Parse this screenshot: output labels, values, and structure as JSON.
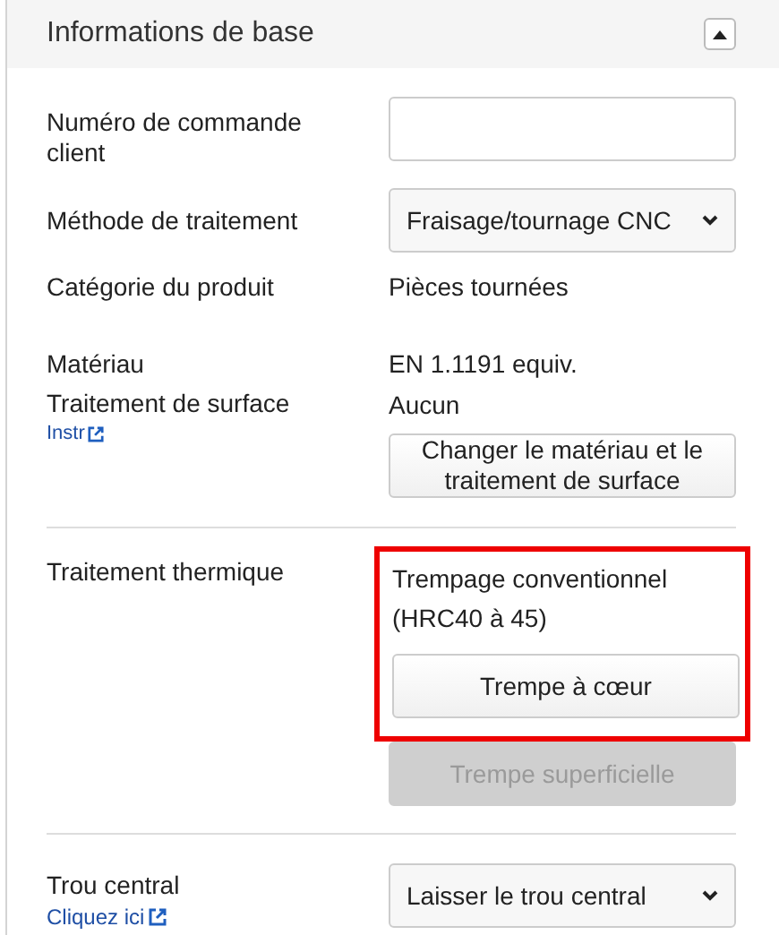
{
  "panel": {
    "title": "Informations de base",
    "expanded": true
  },
  "order_number": {
    "label": "Numéro de commande client"
  },
  "method": {
    "label": "Méthode de traitement",
    "value": "Fraisage/tournage CNC"
  },
  "category": {
    "label": "Catégorie du produit",
    "value": "Pièces tournées"
  },
  "material": {
    "label": "Matériau",
    "value": "EN 1.1191 equiv."
  },
  "surface_treatment": {
    "label": "Traitement de surface",
    "link": "Instr",
    "value": "Aucun"
  },
  "change_button": "Changer le matériau et le traitement de surface",
  "heat_treatment": {
    "label": "Traitement thermique",
    "description": "Trempage conventionnel (HRC40 à 45)",
    "highlighted": true,
    "options": [
      {
        "label": "Trempe à cœur",
        "disabled": false
      },
      {
        "label": "Trempe superficielle",
        "disabled": true
      }
    ]
  },
  "center_hole": {
    "label": "Trou central",
    "link": "Cliquez ici",
    "value": "Laisser le trou central"
  }
}
